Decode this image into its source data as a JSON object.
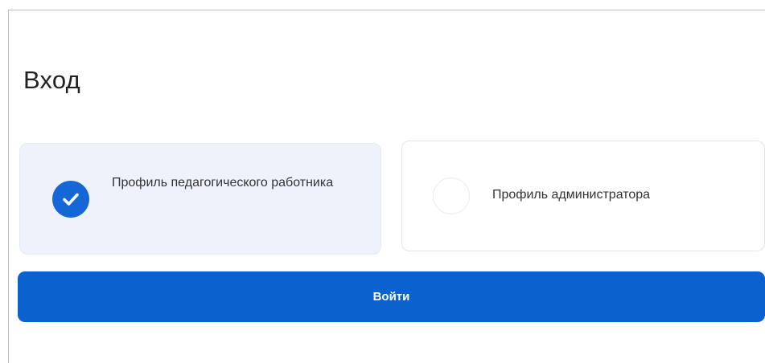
{
  "login": {
    "title": "Вход",
    "profiles": [
      {
        "label": "Профиль педагогического работника",
        "selected": true,
        "icon": "check-circle-icon"
      },
      {
        "label": "Профиль администратора",
        "selected": false,
        "icon": "radio-empty-icon"
      }
    ],
    "submit_label": "Войти"
  },
  "colors": {
    "accent": "#0a62cf",
    "selected_card_bg": "#eef3fb",
    "check": "#1567d6"
  }
}
